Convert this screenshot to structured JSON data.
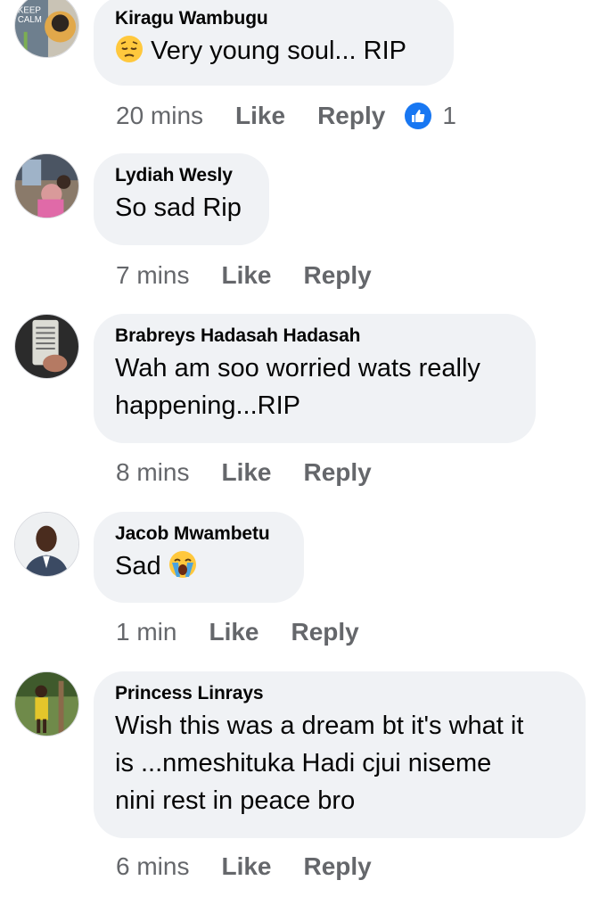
{
  "comments": [
    {
      "author": "Kiragu Wambugu",
      "text": "Very young soul... RIP",
      "time": "20 mins",
      "like_label": "Like",
      "reply_label": "Reply",
      "reaction_count": "1",
      "reaction_icon": "thumbs-up-icon",
      "emoji": "pensive-face-emoji",
      "avatar_text": "KEEP CALM AND ..."
    },
    {
      "author": "Lydiah Wesly",
      "text": "So sad Rip",
      "time": "7 mins",
      "like_label": "Like",
      "reply_label": "Reply"
    },
    {
      "author": "Brabreys Hadasah Hadasah",
      "text_line1": "Wah am soo worried wats really",
      "text_line2": "happening...RIP",
      "time": "8 mins",
      "like_label": "Like",
      "reply_label": "Reply"
    },
    {
      "author": "Jacob Mwambetu",
      "text": "Sad",
      "emoji": "loudly-crying-face-emoji",
      "time": "1 min",
      "like_label": "Like",
      "reply_label": "Reply"
    },
    {
      "author": "Princess Linrays",
      "text_line1": "Wish this was a dream bt it's what it",
      "text_line2": "is ...nmeshituka Hadi cjui niseme",
      "text_line3": "nini rest in peace bro",
      "time": "6 mins",
      "like_label": "Like",
      "reply_label": "Reply"
    }
  ],
  "colors": {
    "bubble_bg": "#f0f2f5",
    "meta_text": "#65676b",
    "reaction_blue": "#1877f2",
    "primary_text": "#050505"
  }
}
